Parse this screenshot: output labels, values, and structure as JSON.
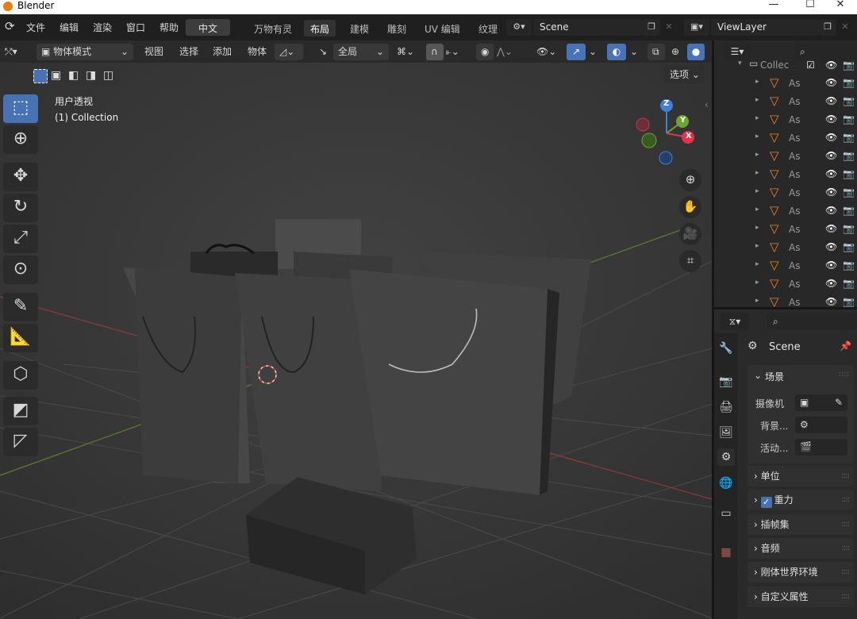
{
  "window": {
    "title": "Blender",
    "minimize": "—",
    "maximize": "☐",
    "close": "✕"
  },
  "menus": [
    "文件",
    "编辑",
    "渲染",
    "窗口",
    "帮助"
  ],
  "language_button": "中文",
  "workspaces": [
    "万物有灵",
    "布局",
    "建模",
    "雕刻",
    "UV 编辑",
    "纹理"
  ],
  "active_workspace": "布局",
  "scene_name": "Scene",
  "viewlayer_name": "ViewLayer",
  "viewport_header": {
    "mode": "物体模式",
    "menus": [
      "视图",
      "选择",
      "添加",
      "物体"
    ],
    "transform_orientation": "全局",
    "options_label": "选项"
  },
  "viewport_overlay": {
    "view_name": "用户透视",
    "collection_label": "(1) Collection"
  },
  "gizmo_axes": {
    "z": "Z",
    "y": "Y",
    "x": "X"
  },
  "outliner": {
    "collection_label": "Collec",
    "items": [
      "As",
      "As",
      "As",
      "As",
      "As",
      "As",
      "As",
      "As",
      "As",
      "As",
      "As",
      "As",
      "As"
    ]
  },
  "properties": {
    "scene_header": "Scene",
    "section_scene": "场景",
    "camera_label": "摄像机",
    "background_label": "背景...",
    "active_clip_label": "活动...",
    "panels": [
      "单位",
      "重力",
      "插帧集",
      "音频",
      "刚体世界环境",
      "自定义属性"
    ],
    "gravity_checked": true
  },
  "colors": {
    "accent": "#4772b3",
    "x_axis": "#e6334a",
    "y_axis": "#6aa82d",
    "z_axis": "#3d7fd9",
    "icon_orange": "#e8832a"
  }
}
